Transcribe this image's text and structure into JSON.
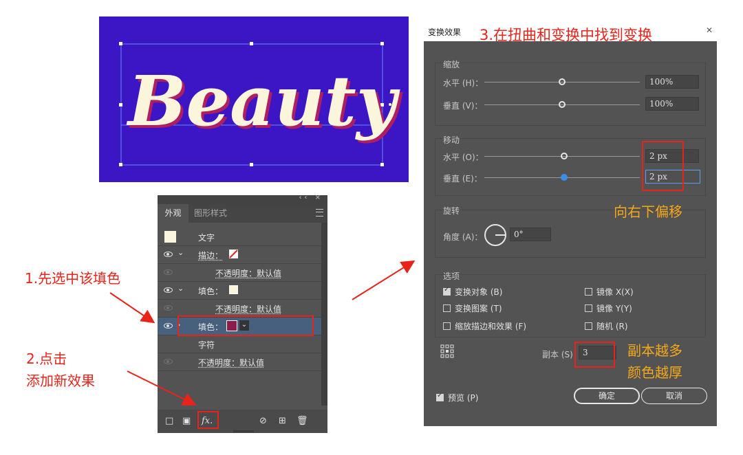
{
  "artboard": {
    "text": "Beauty",
    "bg_color": "#3c16c4",
    "text_color": "#fbf5dc",
    "shadow_color": "#b01e62"
  },
  "appearance_panel": {
    "collapse_icon": "‹‹ ×",
    "tabs": [
      {
        "label": "外观",
        "active": true
      },
      {
        "label": "图形样式",
        "active": false
      }
    ],
    "rows": [
      {
        "label": "文字"
      },
      {
        "label": "描边："
      },
      {
        "label": "不透明度：默认值"
      },
      {
        "label": "填色："
      },
      {
        "label": "不透明度：默认值"
      },
      {
        "label": "填色："
      },
      {
        "label": "字符"
      },
      {
        "label": "不透明度：默认值"
      }
    ],
    "bottom_icons": [
      "add-stroke-icon",
      "add-fill-icon",
      "fx-icon",
      "clear-icon",
      "duplicate-icon",
      "trash-icon"
    ],
    "fx_label": "fx."
  },
  "dialog": {
    "title": "变换效果",
    "scale": {
      "label": "缩放",
      "horizontal_label": "水平 (H)：",
      "horizontal_value": "100%",
      "vertical_label": "垂直 (V)：",
      "vertical_value": "100%"
    },
    "move": {
      "label": "移动",
      "horizontal_label": "水平 (O)：",
      "horizontal_value": "2 px",
      "vertical_label": "垂直 (E)：",
      "vertical_value": "2 px"
    },
    "rotate": {
      "label": "旋转",
      "angle_label": "角度 (A)：",
      "angle_value": "0°"
    },
    "options": {
      "label": "选项",
      "transform_objects": "变换对象 (B)",
      "transform_patterns": "变换图案 (T)",
      "scale_strokes": "缩放描边和效果 (F)",
      "reflect_x": "镜像 X(X)",
      "reflect_y": "镜像 Y(Y)",
      "random": "随机 (R)"
    },
    "copies_label": "副本 (S)",
    "copies_value": "3",
    "preview_label": "预览 (P)",
    "ok_label": "确定",
    "cancel_label": "取消"
  },
  "annotations": {
    "step1": "1.先选中该填色",
    "step2_line1": "2.点击",
    "step2_line2": "添加新效果",
    "step3": "3.在扭曲和变换中找到变换",
    "offset_note": "向右下偏移",
    "copies_note_line1": "副本越多",
    "copies_note_line2": "颜色越厚"
  },
  "colors": {
    "annotation_red": "#e8231a",
    "annotation_gold": "#f6a81b",
    "panel_bg": "#535353",
    "selected_row": "#46607e"
  }
}
